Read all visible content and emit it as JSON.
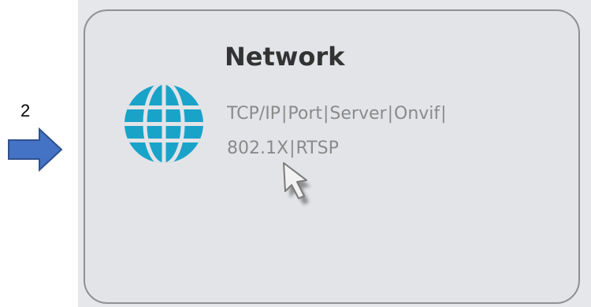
{
  "step": {
    "number": "2"
  },
  "card": {
    "title": "Network",
    "links": [
      {
        "label": "TCP/IP"
      },
      {
        "label": "Port"
      },
      {
        "label": "Server"
      },
      {
        "label": "Onvif"
      },
      {
        "label": "802.1X"
      },
      {
        "label": "RTSP"
      }
    ],
    "separator": "|",
    "icon": "globe-icon"
  },
  "colors": {
    "card_bg": "#e3e4e8",
    "card_border": "#8f8f94",
    "globe": "#1aa3c9",
    "title": "#333333",
    "link": "#8a8a8a",
    "arrow_fill": "#4472c4",
    "arrow_stroke": "#2f528f"
  },
  "indicator_icon": "right-arrow-icon",
  "cursor_icon": "mouse-pointer-icon"
}
